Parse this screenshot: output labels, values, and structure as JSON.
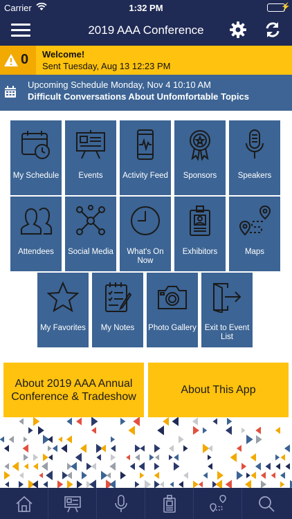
{
  "status_bar": {
    "carrier": "Carrier",
    "time": "1:32 PM",
    "battery_level": 1.0
  },
  "header": {
    "title": "2019 AAA Conference",
    "menu_icon": "menu-icon",
    "settings_icon": "gear-icon",
    "refresh_icon": "refresh-icon"
  },
  "welcome": {
    "count": "0",
    "title": "Welcome!",
    "subtitle": "Sent Tuesday, Aug 13 12:23 PM",
    "icon": "warning-icon"
  },
  "upcoming": {
    "line1": "Upcoming Schedule Monday, Nov 4 10:10 AM",
    "line2": "Difficult Conversations About Unfomfortable Topics",
    "icon": "calendar-icon"
  },
  "tiles": [
    {
      "label": "My Schedule",
      "icon": "calendar-clock-icon"
    },
    {
      "label": "Events",
      "icon": "presentation-icon"
    },
    {
      "label": "Activity Feed",
      "icon": "phone-pulse-icon"
    },
    {
      "label": "Sponsors",
      "icon": "award-icon"
    },
    {
      "label": "Speakers",
      "icon": "microphone-icon"
    },
    {
      "label": "Attendees",
      "icon": "people-icon"
    },
    {
      "label": "Social Media",
      "icon": "network-icon"
    },
    {
      "label": "What's On Now",
      "icon": "clock-icon"
    },
    {
      "label": "Exhibitors",
      "icon": "badge-icon"
    },
    {
      "label": "Maps",
      "icon": "map-route-icon"
    },
    {
      "label": "My Favorites",
      "icon": "star-icon"
    },
    {
      "label": "My Notes",
      "icon": "notes-icon"
    },
    {
      "label": "Photo Gallery",
      "icon": "camera-icon"
    },
    {
      "label": "Exit to Event List",
      "icon": "exit-icon"
    }
  ],
  "buttons": {
    "about_conference": "About 2019 AAA Annual Conference & Tradeshow",
    "about_app": "About This App"
  },
  "tabbar": [
    "home-icon",
    "presentation-icon",
    "microphone-icon",
    "badge-icon",
    "map-route-icon",
    "search-icon"
  ],
  "colors": {
    "navy": "#1f2a55",
    "tile_blue": "#3c6494",
    "yellow": "#ffc20e"
  }
}
